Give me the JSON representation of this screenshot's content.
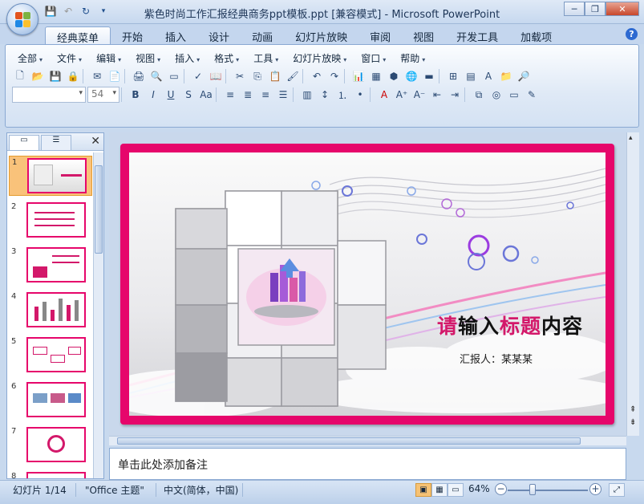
{
  "window": {
    "title": "紫色时尚工作汇报经典商务ppt模板.ppt [兼容模式] - Microsoft PowerPoint",
    "min": "─",
    "max": "❐",
    "close": "✕"
  },
  "qat": [
    "save-icon",
    "undo-icon",
    "redo-icon",
    "customize-icon"
  ],
  "tabs": [
    {
      "label": "经典菜单",
      "active": true
    },
    {
      "label": "开始"
    },
    {
      "label": "插入"
    },
    {
      "label": "设计"
    },
    {
      "label": "动画"
    },
    {
      "label": "幻灯片放映"
    },
    {
      "label": "审阅"
    },
    {
      "label": "视图"
    },
    {
      "label": "开发工具"
    },
    {
      "label": "加载项"
    }
  ],
  "help": "?",
  "menubar": [
    {
      "label": "全部"
    },
    {
      "label": "文件"
    },
    {
      "label": "编辑"
    },
    {
      "label": "视图"
    },
    {
      "label": "插入"
    },
    {
      "label": "格式"
    },
    {
      "label": "工具"
    },
    {
      "label": "幻灯片放映"
    },
    {
      "label": "窗口"
    },
    {
      "label": "帮助"
    }
  ],
  "font_size_value": "54",
  "slides_pane": {
    "count": 8,
    "selected": 1,
    "close": "✕"
  },
  "slide": {
    "title_part1": "请",
    "title_part2": "输入",
    "title_part3": "标题",
    "title_part4": "内容",
    "subtitle": "汇报人：某某某",
    "frame_color": "#e6066b",
    "accent_pink": "#d3186a"
  },
  "notes": {
    "placeholder": "单击此处添加备注"
  },
  "status": {
    "slide_info": "幻灯片 1/14",
    "theme": "\"Office 主题\"",
    "language": "中文(简体，中国)",
    "zoom": "64%"
  }
}
